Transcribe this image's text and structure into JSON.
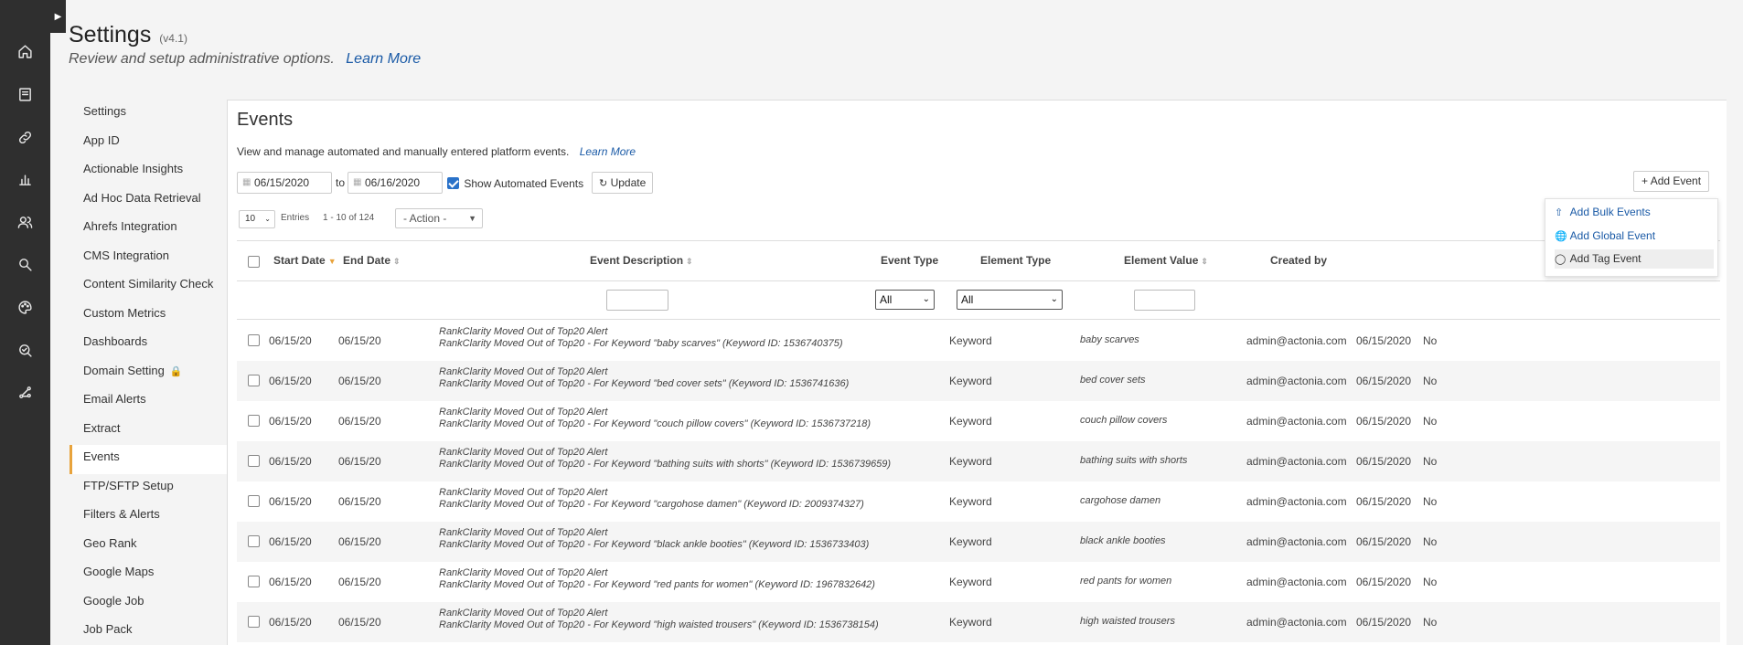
{
  "header": {
    "title": "Settings",
    "version": "(v4.1)",
    "subtitle": "Review and setup administrative options.",
    "learn_more": "Learn More"
  },
  "rail_icons": [
    "home-icon",
    "document-icon",
    "link-icon",
    "bar-chart-icon",
    "users-icon",
    "search-icon",
    "palette-icon",
    "search-check-icon",
    "share-nodes-icon"
  ],
  "nav": {
    "items": [
      "Settings",
      "App ID",
      "Actionable Insights",
      "Ad Hoc Data Retrieval",
      "Ahrefs Integration",
      "CMS Integration",
      "Content Similarity Check",
      "Custom Metrics",
      "Dashboards",
      "Domain Setting",
      "Email Alerts",
      "Extract",
      "Events",
      "FTP/SFTP Setup",
      "Filters & Alerts",
      "Geo Rank",
      "Google Maps",
      "Google Job",
      "Job Pack"
    ],
    "active": "Events"
  },
  "events": {
    "title": "Events",
    "description": "View and manage automated and manually entered platform events.",
    "learn_more": "Learn More",
    "date_from": "06/15/2020",
    "to_label": "to",
    "date_to": "06/16/2020",
    "show_automated_label": "Show Automated Events",
    "show_automated": true,
    "update_label": "Update",
    "add_event_label": "Add Event",
    "page_size": "10",
    "entries_label": "Entries",
    "range_label": "1 - 10 of 124",
    "action_label": "- Action -"
  },
  "add_menu": {
    "items": [
      "Add Bulk Events",
      "Add Global Event",
      "Add Tag Event"
    ]
  },
  "table": {
    "headers": {
      "start_date": "Start Date",
      "end_date": "End Date",
      "description": "Event Description",
      "event_type": "Event Type",
      "element_type": "Element Type",
      "element_value": "Element Value",
      "created_by": "Created by"
    },
    "filters": {
      "event_type": "All",
      "element_type": "All"
    },
    "rows": [
      {
        "start": "06/15/20",
        "end": "06/15/20",
        "line1": "RankClarity Moved Out of Top20 Alert",
        "line2": "RankClarity Moved Out of Top20 - For Keyword \"baby scarves\" (Keyword ID: 1536740375)",
        "element_type": "Keyword",
        "value": "baby scarves",
        "created_by": "admin@actonia.com",
        "created": "06/15/2020",
        "flag": "No"
      },
      {
        "start": "06/15/20",
        "end": "06/15/20",
        "line1": "RankClarity Moved Out of Top20 Alert",
        "line2": "RankClarity Moved Out of Top20 - For Keyword \"bed cover sets\" (Keyword ID: 1536741636)",
        "element_type": "Keyword",
        "value": "bed cover sets",
        "created_by": "admin@actonia.com",
        "created": "06/15/2020",
        "flag": "No"
      },
      {
        "start": "06/15/20",
        "end": "06/15/20",
        "line1": "RankClarity Moved Out of Top20 Alert",
        "line2": "RankClarity Moved Out of Top20 - For Keyword \"couch pillow covers\" (Keyword ID: 1536737218)",
        "element_type": "Keyword",
        "value": "couch pillow covers",
        "created_by": "admin@actonia.com",
        "created": "06/15/2020",
        "flag": "No"
      },
      {
        "start": "06/15/20",
        "end": "06/15/20",
        "line1": "RankClarity Moved Out of Top20 Alert",
        "line2": "RankClarity Moved Out of Top20 - For Keyword \"bathing suits with shorts\" (Keyword ID: 1536739659)",
        "element_type": "Keyword",
        "value": "bathing suits with shorts",
        "created_by": "admin@actonia.com",
        "created": "06/15/2020",
        "flag": "No"
      },
      {
        "start": "06/15/20",
        "end": "06/15/20",
        "line1": "RankClarity Moved Out of Top20 Alert",
        "line2": "RankClarity Moved Out of Top20 - For Keyword \"cargohose damen\" (Keyword ID: 2009374327)",
        "element_type": "Keyword",
        "value": "cargohose damen",
        "created_by": "admin@actonia.com",
        "created": "06/15/2020",
        "flag": "No"
      },
      {
        "start": "06/15/20",
        "end": "06/15/20",
        "line1": "RankClarity Moved Out of Top20 Alert",
        "line2": "RankClarity Moved Out of Top20 - For Keyword \"black ankle booties\" (Keyword ID: 1536733403)",
        "element_type": "Keyword",
        "value": "black ankle booties",
        "created_by": "admin@actonia.com",
        "created": "06/15/2020",
        "flag": "No"
      },
      {
        "start": "06/15/20",
        "end": "06/15/20",
        "line1": "RankClarity Moved Out of Top20 Alert",
        "line2": "RankClarity Moved Out of Top20 - For Keyword \"red pants for women\" (Keyword ID: 1967832642)",
        "element_type": "Keyword",
        "value": "red pants for women",
        "created_by": "admin@actonia.com",
        "created": "06/15/2020",
        "flag": "No"
      },
      {
        "start": "06/15/20",
        "end": "06/15/20",
        "line1": "RankClarity Moved Out of Top20 Alert",
        "line2": "RankClarity Moved Out of Top20 - For Keyword \"high waisted trousers\" (Keyword ID: 1536738154)",
        "element_type": "Keyword",
        "value": "high waisted trousers",
        "created_by": "admin@actonia.com",
        "created": "06/15/2020",
        "flag": "No"
      }
    ]
  },
  "colors": {
    "rail": "#2f2f2f",
    "link": "#1a5aa6",
    "accent": "#e8a33c",
    "checkbox": "#2a72c9"
  }
}
